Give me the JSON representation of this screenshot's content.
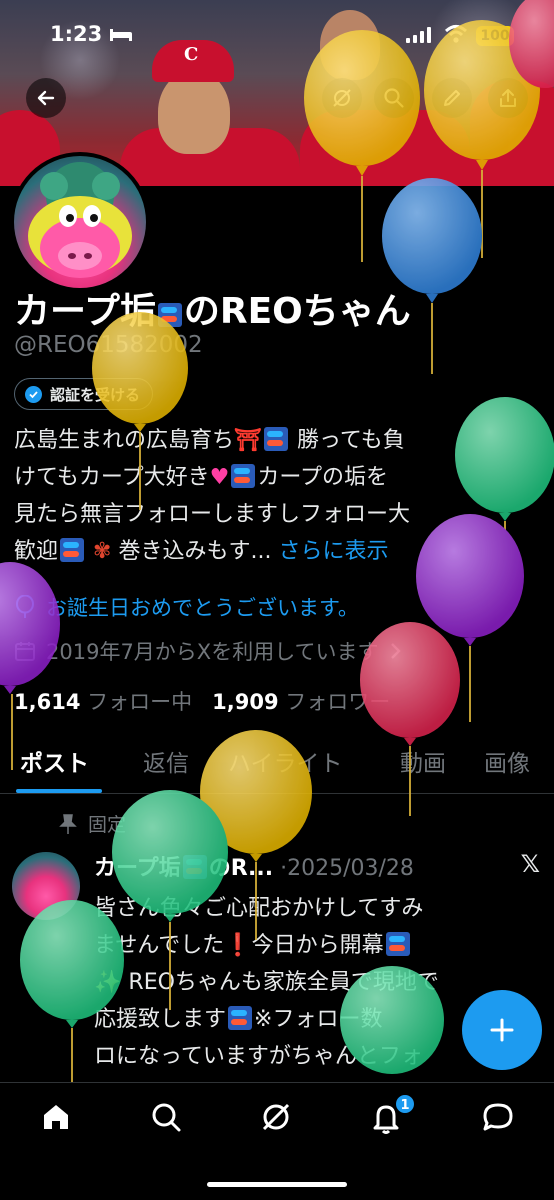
{
  "status_bar": {
    "time": "1:23",
    "battery": "100"
  },
  "banner": {
    "cap_logo": "C"
  },
  "profile": {
    "name": "カープ垢",
    "name_suffix": "のREOちゃん",
    "handle": "@REO61582002",
    "verify_label": "認証を受ける"
  },
  "bio": {
    "line1_a": "広島生まれの広島育ち",
    "line1_b": "勝っても負",
    "line2_a": "けてもカープ大好き",
    "line2_b": "カープの垢を",
    "line3": "見たら無言フォローしますしフォロー大",
    "line4_a": "歓迎",
    "line4_b": "巻き込みもす...",
    "more": "さらに表示"
  },
  "birthday_text": "お誕生日おめでとうございます。",
  "joined_text": "2019年7月からXを利用しています",
  "follow": {
    "following_count": "1,614",
    "following_label": "フォロー中",
    "followers_count": "1,909",
    "followers_label": "フォロワー"
  },
  "tabs": [
    "ポスト",
    "返信",
    "ハイライト",
    "動画",
    "画像"
  ],
  "pinned_post": {
    "pinned_label": "固定",
    "name": "カープ垢",
    "name_suffix": "のR...",
    "date": "·2025/03/28",
    "text_1": "皆さん色々ご心配おかけしてすみ",
    "text_2": "ませんでした",
    "text_2b": "今日から開幕",
    "text_3": "REOちゃんも家族全員で現地で",
    "text_4": "応援致します",
    "text_4b": "※フォロー数",
    "text_5": "ロになっていますがちゃんとフォ"
  },
  "bottom_nav": {
    "notification_count": "1"
  },
  "colors": {
    "accent": "#1d9bf0",
    "background": "#000000",
    "muted": "#71767b",
    "balloon_yellow": "#f2c31b",
    "balloon_blue": "#3a8fe0",
    "balloon_green": "#2fd08f",
    "balloon_purple": "#9b2fd0",
    "balloon_red": "#e0335c"
  }
}
